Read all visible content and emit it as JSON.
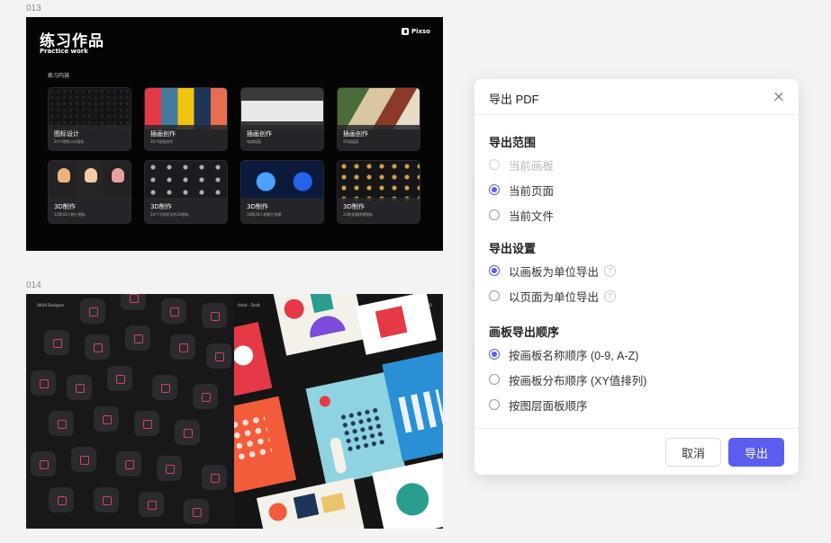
{
  "canvas": {
    "frame_013_label": "013",
    "frame_014_label": "014"
  },
  "artboard_013": {
    "title": "练习作品",
    "subtitle": "Practice work",
    "logo_text": "Pixso",
    "section_title": "练习内容",
    "cards": [
      {
        "title": "图标设计",
        "sub": "24个线性icon图标"
      },
      {
        "title": "插画创作",
        "sub": "30个插画创作"
      },
      {
        "title": "插画创作",
        "sub": "电商插画"
      },
      {
        "title": "插画创作",
        "sub": "45张插画"
      },
      {
        "title": "3D制作",
        "sub": "12款3D人物小图标"
      },
      {
        "title": "3D制作",
        "sub": "24个不同样式的3D图标"
      },
      {
        "title": "3D制作",
        "sub": "16款3D人物胶片效果"
      },
      {
        "title": "3D制作",
        "sub": "24款金属质感图标"
      }
    ]
  },
  "artboard_014": {
    "tag_left": "UI/UX Designer",
    "tag_mid": "Artist - Draft",
    "tag_right": "LOGO"
  },
  "dialog": {
    "title": "导出 PDF",
    "section_range": "导出范围",
    "range_options": [
      {
        "label": "当前画板",
        "state": "disabled"
      },
      {
        "label": "当前页面",
        "state": "checked"
      },
      {
        "label": "当前文件",
        "state": "unchecked"
      }
    ],
    "section_settings": "导出设置",
    "settings_options": [
      {
        "label": "以画板为单位导出",
        "state": "checked",
        "help": "?"
      },
      {
        "label": "以页面为单位导出",
        "state": "unchecked",
        "help": "?"
      }
    ],
    "section_order": "画板导出顺序",
    "order_options": [
      {
        "label": "按画板名称顺序 (0-9, A-Z)",
        "state": "checked"
      },
      {
        "label": "按画板分布顺序 (XY值排列)",
        "state": "unchecked"
      },
      {
        "label": "按图层面板顺序",
        "state": "unchecked"
      }
    ],
    "cancel_label": "取消",
    "export_label": "导出",
    "accent_color": "#5b5cf0"
  }
}
